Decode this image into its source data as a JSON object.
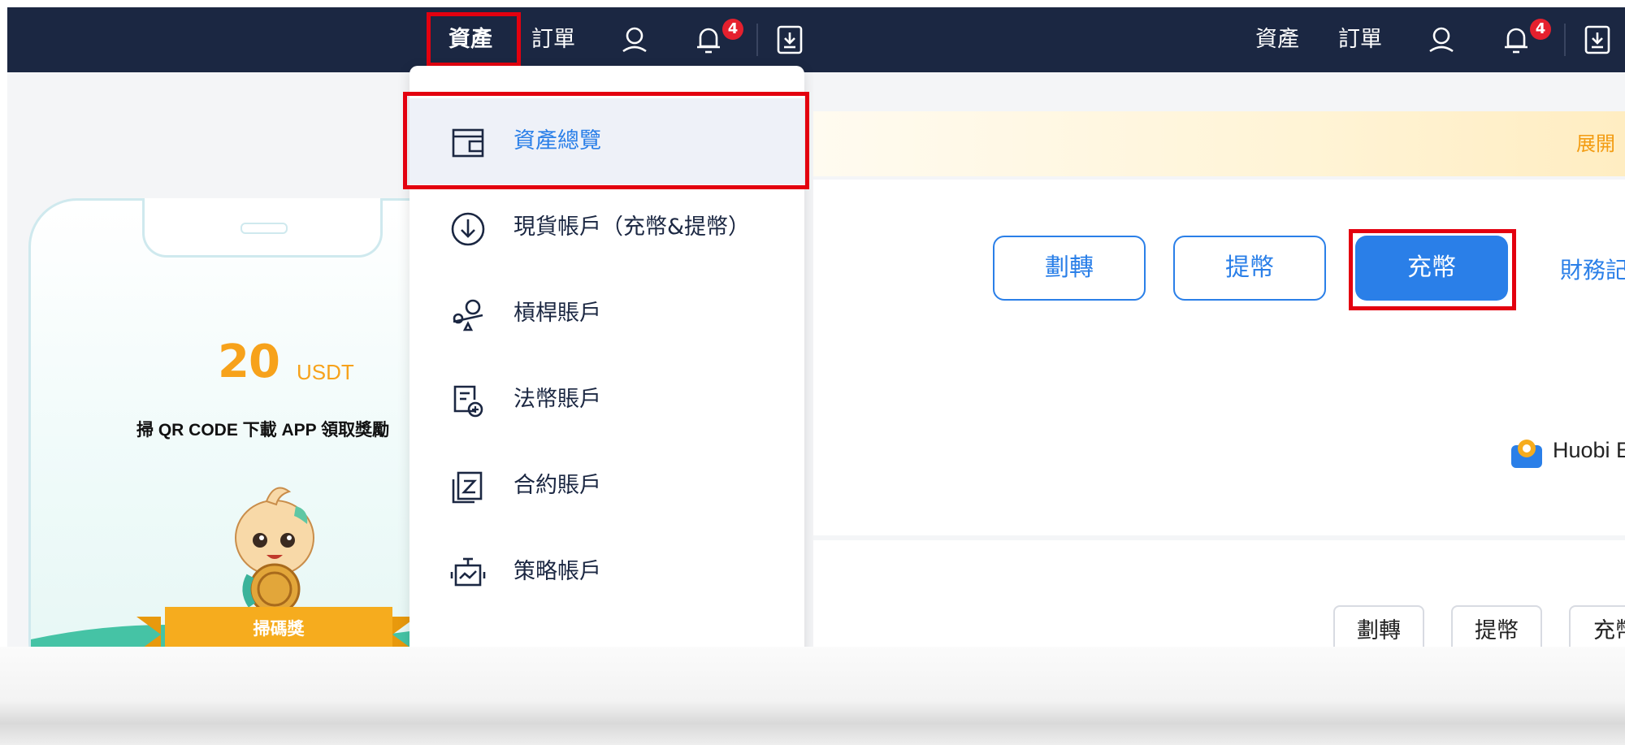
{
  "left": {
    "nav": {
      "assets": "資產",
      "orders": "訂單",
      "notification_count": "4"
    },
    "dropdown": [
      {
        "label": "資產總覽",
        "icon": "wallet-icon",
        "active": true
      },
      {
        "label": "現貨帳戶（充幣&提幣）",
        "icon": "download-circle-icon"
      },
      {
        "label": "槓桿賬戶",
        "icon": "leverage-icon"
      },
      {
        "label": "法幣賬戶",
        "icon": "fiat-document-icon"
      },
      {
        "label": "合約賬戶",
        "icon": "contract-icon"
      },
      {
        "label": "策略帳戶",
        "icon": "strategy-bot-icon"
      }
    ],
    "promo": {
      "amount": "20",
      "unit": "USDT",
      "subtitle": "掃 QR CODE 下載 APP 領取獎勵",
      "ribbon": "掃碼獎"
    }
  },
  "right": {
    "nav": {
      "assets": "資產",
      "orders": "訂單",
      "notification_count": "4"
    },
    "notice_text": "展開",
    "buttons": {
      "transfer": "劃轉",
      "withdraw": "提幣",
      "deposit": "充幣",
      "finance_records": "財務記錄"
    },
    "brand": "Huobi E",
    "secondary_buttons": {
      "transfer": "劃轉",
      "withdraw": "提幣",
      "deposit": "充幣"
    }
  },
  "colors": {
    "navbar": "#1b2742",
    "accent_blue": "#2a7fe8",
    "highlight_red": "#e3000f",
    "promo_orange": "#f7a21b",
    "badge_red": "#e5202e"
  }
}
